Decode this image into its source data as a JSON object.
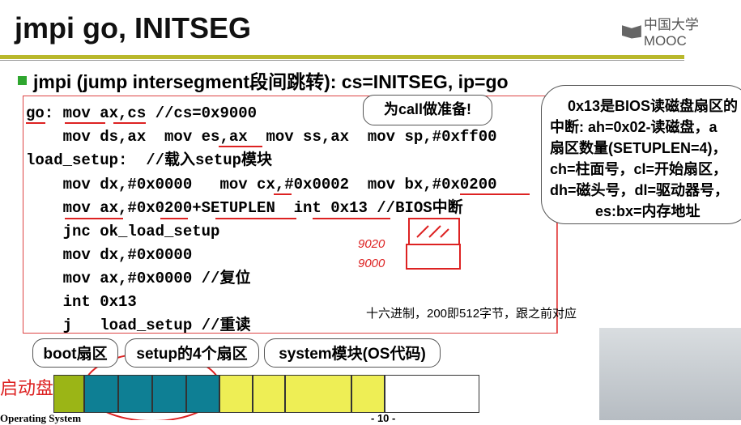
{
  "title": "jmpi go, INITSEG",
  "logo": "中国大学MOOC",
  "bullet": "jmpi (jump intersegment段间跳转): cs=INITSEG, ip=go",
  "code": [
    "go: mov ax,cs //cs=0x9000",
    "    mov ds,ax  mov es,ax  mov ss,ax  mov sp,#0xff00",
    "load_setup:  //载入setup模块",
    "    mov dx,#0x0000   mov cx,#0x0002  mov bx,#0x0200",
    "    mov ax,#0x0200+SETUPLEN  int 0x13 //BIOS中断",
    "    jnc ok_load_setup",
    "    mov dx,#0x0000",
    "    mov ax,#0x0000 //复位",
    "    int 0x13",
    "    j   load_setup //重读"
  ],
  "callout_call": "为call做准备!",
  "callout_bios": [
    "0x13是BIOS读磁盘扇区的",
    "中断: ah=0x02-读磁盘，a",
    "扇区数量(SETUPLEN=4)，",
    "ch=柱面号，cl=开始扇区，",
    "dh=磁头号，dl=驱动器号，",
    "es:bx=内存地址"
  ],
  "handwriting": [
    "9020",
    "9000"
  ],
  "subtitle": "十六进制，200即512字节，跟之前对应",
  "disk": {
    "label": "启动盘",
    "boot": "boot扇区",
    "setup": "setup的4个扇区",
    "system": "system模块(OS代码)"
  },
  "footer": "Operating System",
  "page": "- 10 -",
  "colors": {
    "boot": "#9bb516",
    "setup": "#0e7f94",
    "system": "#eeee55",
    "accent": "#d22"
  }
}
